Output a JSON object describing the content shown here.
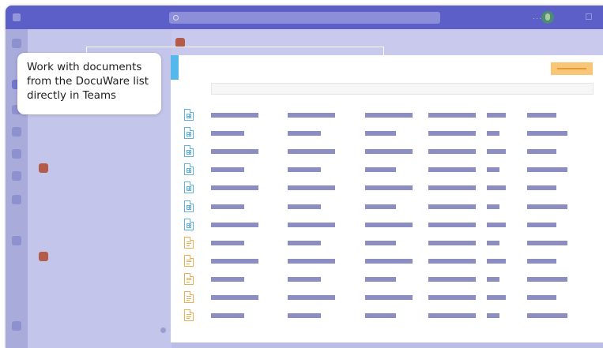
{
  "callout": {
    "line1": "Work with documents",
    "line2": "from the DocuWare list",
    "line3": "directly in Teams"
  },
  "colors": {
    "teams_purple": "#5b5fc7",
    "dim_overlay": "#bbbde6",
    "docuware_accent": "#56b7ea",
    "docuware_button": "#f8c675",
    "placeholder_bar": "#8c8ec2",
    "sheet_icon": "#5bb1e8",
    "text_icon": "#f1ad4b"
  },
  "icons": {
    "app_launcher": "grid-icon",
    "search": "search-icon",
    "profile": "avatar",
    "spreadsheet_document": "spreadsheet-document-icon",
    "text_document": "text-document-icon"
  },
  "documents": [
    {
      "type": "spreadsheet"
    },
    {
      "type": "spreadsheet"
    },
    {
      "type": "spreadsheet"
    },
    {
      "type": "spreadsheet"
    },
    {
      "type": "spreadsheet"
    },
    {
      "type": "spreadsheet"
    },
    {
      "type": "spreadsheet"
    },
    {
      "type": "text"
    },
    {
      "type": "text"
    },
    {
      "type": "text"
    },
    {
      "type": "text"
    },
    {
      "type": "text"
    }
  ]
}
